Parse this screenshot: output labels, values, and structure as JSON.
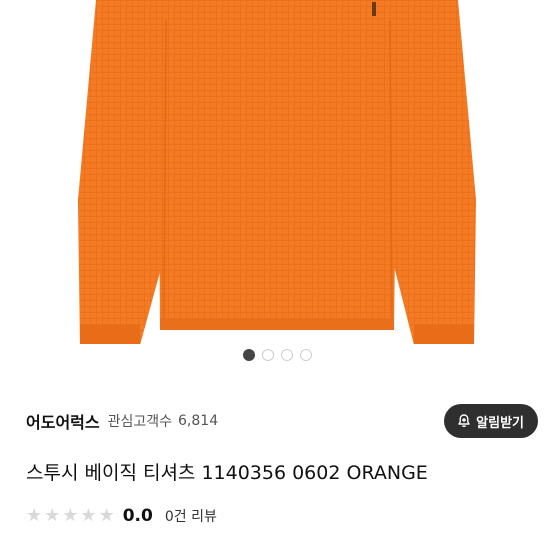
{
  "product": {
    "image": {
      "description_icon": "orange-knit-sweater-photo",
      "color": "#f47a24"
    },
    "carousel": {
      "total": 4,
      "active_index": 0
    },
    "brand": "어도어럭스",
    "interest_label": "관심고객수",
    "interest_count": "6,814",
    "alarm_label": "알림받기",
    "alarm_icon": "bell-plus-icon",
    "title": "스투시 베이직 티셔츠 1140356 0602 ORANGE",
    "rating": {
      "score": "0.0",
      "stars_filled": 0,
      "stars_total": 5,
      "review_count": "0건 리뷰"
    }
  }
}
